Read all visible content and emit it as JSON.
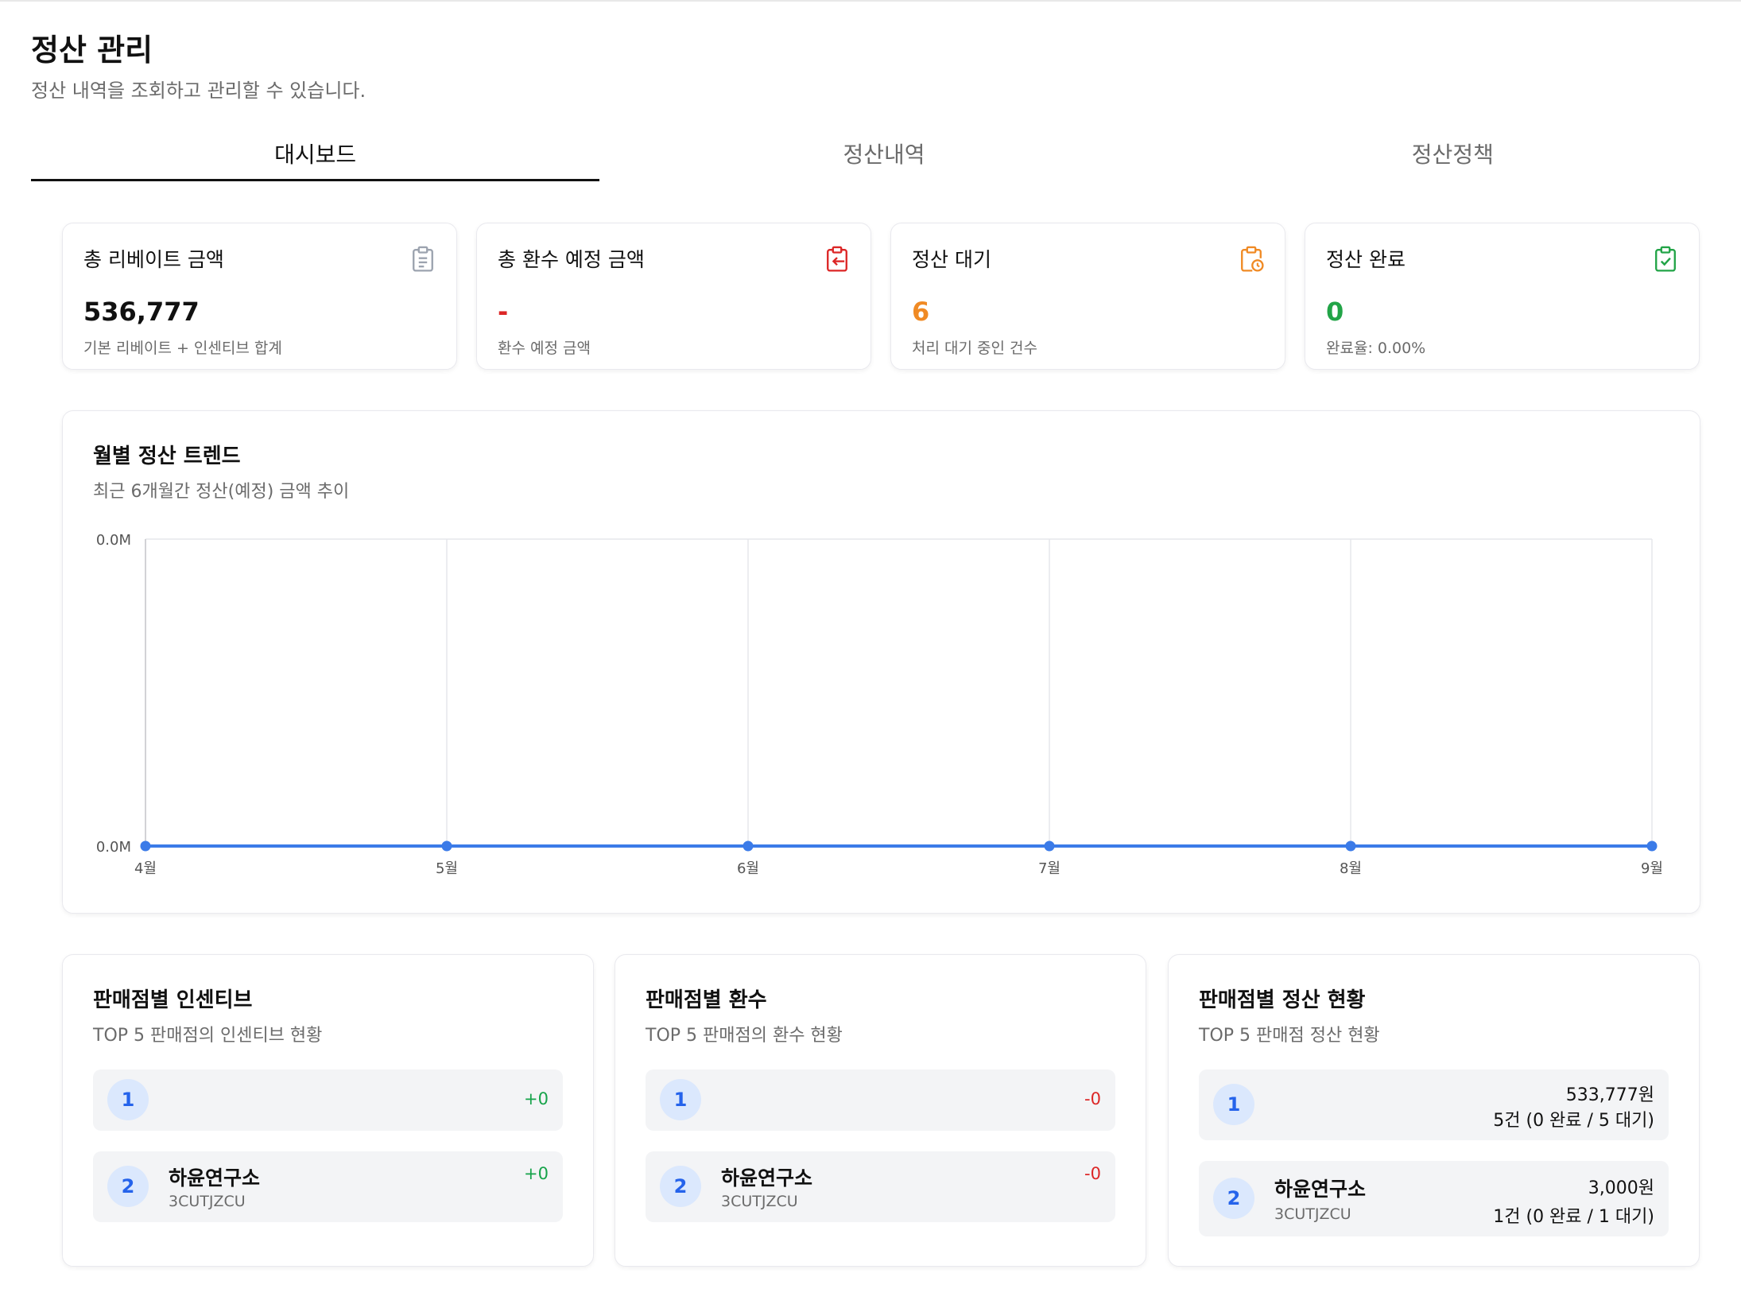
{
  "header": {
    "title": "정산 관리",
    "subtitle": "정산 내역을 조회하고 관리할 수 있습니다."
  },
  "tabs": [
    {
      "label": "대시보드",
      "active": true
    },
    {
      "label": "정산내역",
      "active": false
    },
    {
      "label": "정산정책",
      "active": false
    }
  ],
  "stats": [
    {
      "label": "총 리베이트 금액",
      "value": "536,777",
      "desc": "기본 리베이트 + 인센티브 합계",
      "icon": "clipboard-list-icon",
      "color": "#111111"
    },
    {
      "label": "총 환수 예정 금액",
      "value": "-",
      "desc": "환수 예정 금액",
      "icon": "clipboard-return-icon",
      "color": "#dc2626"
    },
    {
      "label": "정산 대기",
      "value": "6",
      "desc": "처리 대기 중인 건수",
      "icon": "clipboard-clock-icon",
      "color": "#f08a24"
    },
    {
      "label": "정산 완료",
      "value": "0",
      "desc": "완료율: 0.00%",
      "icon": "clipboard-check-icon",
      "color": "#22a447"
    }
  ],
  "trend": {
    "title": "월별 정산 트렌드",
    "subtitle": "최근 6개월간 정산(예정) 금액 추이"
  },
  "chart_data": {
    "type": "line",
    "categories": [
      "4월",
      "5월",
      "6월",
      "7월",
      "8월",
      "9월"
    ],
    "series": [
      {
        "values": [
          0,
          0,
          0,
          0,
          0,
          0
        ],
        "color": "#3b7be8"
      }
    ],
    "y_tick_labels": [
      "0.0M",
      "0.0M"
    ],
    "grid": true
  },
  "panels": {
    "incentive": {
      "title": "판매점별 인센티브",
      "subtitle": "TOP 5 판매점의 인센티브 현황",
      "rows": [
        {
          "rank": "1",
          "name": "",
          "code": "",
          "value": "+0"
        },
        {
          "rank": "2",
          "name": "하윤연구소",
          "code": "3CUTJZCU",
          "value": "+0"
        }
      ]
    },
    "clawback": {
      "title": "판매점별 환수",
      "subtitle": "TOP 5 판매점의 환수 현황",
      "rows": [
        {
          "rank": "1",
          "name": "",
          "code": "",
          "value": "-0"
        },
        {
          "rank": "2",
          "name": "하윤연구소",
          "code": "3CUTJZCU",
          "value": "-0"
        }
      ]
    },
    "settlement": {
      "title": "판매점별 정산 현황",
      "subtitle": "TOP 5 판매점 정산 현황",
      "rows": [
        {
          "rank": "1",
          "name": "",
          "code": "",
          "amount": "533,777원",
          "detail": "5건 (0 완료 / 5 대기)"
        },
        {
          "rank": "2",
          "name": "하윤연구소",
          "code": "3CUTJZCU",
          "amount": "3,000원",
          "detail": "1건 (0 완료 / 1 대기)"
        }
      ]
    }
  }
}
